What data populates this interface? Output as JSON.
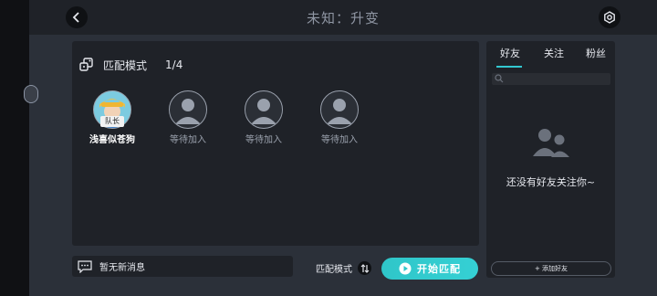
{
  "header": {
    "title": "未知：升变"
  },
  "mode": {
    "label": "匹配模式",
    "count": "1/4"
  },
  "players": [
    {
      "name": "浅喜似苍狗",
      "badge": "队长",
      "role": "leader"
    },
    {
      "name": "等待加入",
      "role": "empty"
    },
    {
      "name": "等待加入",
      "role": "empty"
    },
    {
      "name": "等待加入",
      "role": "empty"
    }
  ],
  "friends": {
    "tabs": [
      {
        "label": "好友",
        "active": true
      },
      {
        "label": "关注"
      },
      {
        "label": "粉丝"
      }
    ],
    "empty_text": "还没有好友关注你~",
    "add_button": "+ 添加好友"
  },
  "chat": {
    "text": "暂无新消息"
  },
  "bottom": {
    "mode_label": "匹配模式",
    "start_label": "开始匹配"
  },
  "colors": {
    "accent": "#33c8d0",
    "panel": "#1f2228",
    "background": "#2b3039"
  }
}
